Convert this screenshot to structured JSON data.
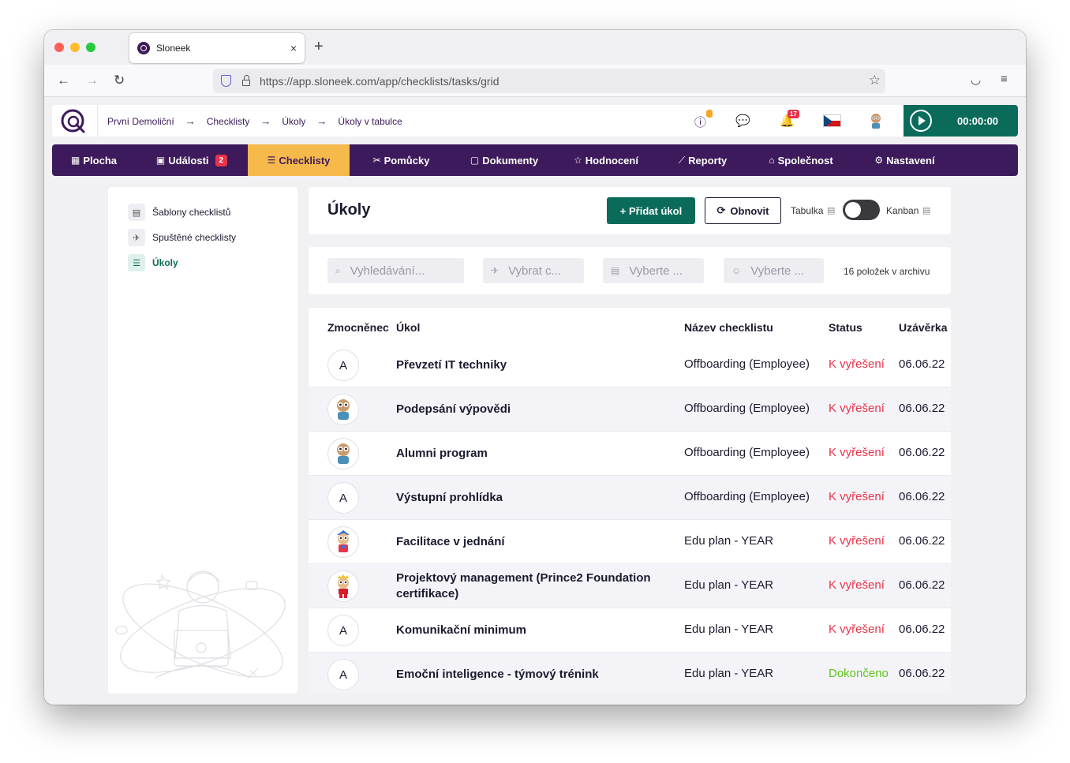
{
  "browser": {
    "tab_title": "Sloneek",
    "tab_close": "×",
    "new_tab": "+",
    "url": "https://app.sloneek.com/app/checklists/tasks/grid"
  },
  "header": {
    "breadcrumb": [
      "První Demoliční",
      "Checklisty",
      "Úkoly",
      "Úkoly v tabulce"
    ],
    "breadcrumb_arrow": "→",
    "notification_count": "17",
    "timer": "00:00:00"
  },
  "nav": {
    "items": [
      {
        "label": "Plocha",
        "icon": "▦"
      },
      {
        "label": "Události",
        "icon": "▣",
        "badge": "2"
      },
      {
        "label": "Checklisty",
        "icon": "☰",
        "active": true
      },
      {
        "label": "Pomůcky",
        "icon": "✂"
      },
      {
        "label": "Dokumenty",
        "icon": "▢"
      },
      {
        "label": "Hodnocení",
        "icon": "☆"
      },
      {
        "label": "Reporty",
        "icon": "⟋"
      },
      {
        "label": "Společnost",
        "icon": "⌂"
      },
      {
        "label": "Nastavení",
        "icon": "⚙"
      }
    ]
  },
  "sidebar": {
    "items": [
      {
        "label": "Šablony checklistů",
        "icon": "▤"
      },
      {
        "label": "Spuštěné checklisty",
        "icon": "✈"
      },
      {
        "label": "Úkoly",
        "icon": "☰"
      }
    ]
  },
  "page": {
    "title": "Úkoly",
    "add_button": "+ Přidat úkol",
    "refresh_button": "Obnovit",
    "toggle_left": "Tabulka",
    "toggle_right": "Kanban"
  },
  "filters": {
    "search_placeholder": "Vyhledávání...",
    "checklist_placeholder": "Vybrat c...",
    "filter3_placeholder": "Vyberte ...",
    "filter4_placeholder": "Vyberte ...",
    "archive_text": "16 položek v archivu"
  },
  "table": {
    "headers": [
      "Zmocněnec",
      "Úkol",
      "Název checklistu",
      "Status",
      "Uzávěrka"
    ],
    "rows": [
      {
        "avatar": "A",
        "task": "Převzetí IT techniky",
        "checklist": "Offboarding (Employee)",
        "status": "K vyřešení",
        "date": "06.06.22"
      },
      {
        "avatar": "",
        "task": "Podepsání výpovědi",
        "checklist": "Offboarding (Employee)",
        "status": "K vyřešení",
        "date": "06.06.22"
      },
      {
        "avatar": "",
        "task": "Alumni program",
        "checklist": "Offboarding (Employee)",
        "status": "K vyřešení",
        "date": "06.06.22"
      },
      {
        "avatar": "A",
        "task": "Výstupní prohlídka",
        "checklist": "Offboarding (Employee)",
        "status": "K vyřešení",
        "date": "06.06.22"
      },
      {
        "avatar": "",
        "task": "Facilitace v jednání",
        "checklist": "Edu plan - YEAR",
        "status": "K vyřešení",
        "date": "06.06.22"
      },
      {
        "avatar": "",
        "task": "Projektový management (Prince2 Foundation certifikace)",
        "checklist": "Edu plan - YEAR",
        "status": "K vyřešení",
        "date": "06.06.22"
      },
      {
        "avatar": "A",
        "task": "Komunikační minimum",
        "checklist": "Edu plan - YEAR",
        "status": "K vyřešení",
        "date": "06.06.22"
      },
      {
        "avatar": "A",
        "task": "Emoční inteligence - týmový trénink",
        "checklist": "Edu plan - YEAR",
        "status": "Dokončeno",
        "date": "06.06.22"
      }
    ]
  },
  "colors": {
    "brand": "#3d1a5b",
    "accent": "#0b6b5b",
    "active_nav": "#f6b94c",
    "status_open": "#e8334a",
    "status_done": "#5cc41a"
  }
}
